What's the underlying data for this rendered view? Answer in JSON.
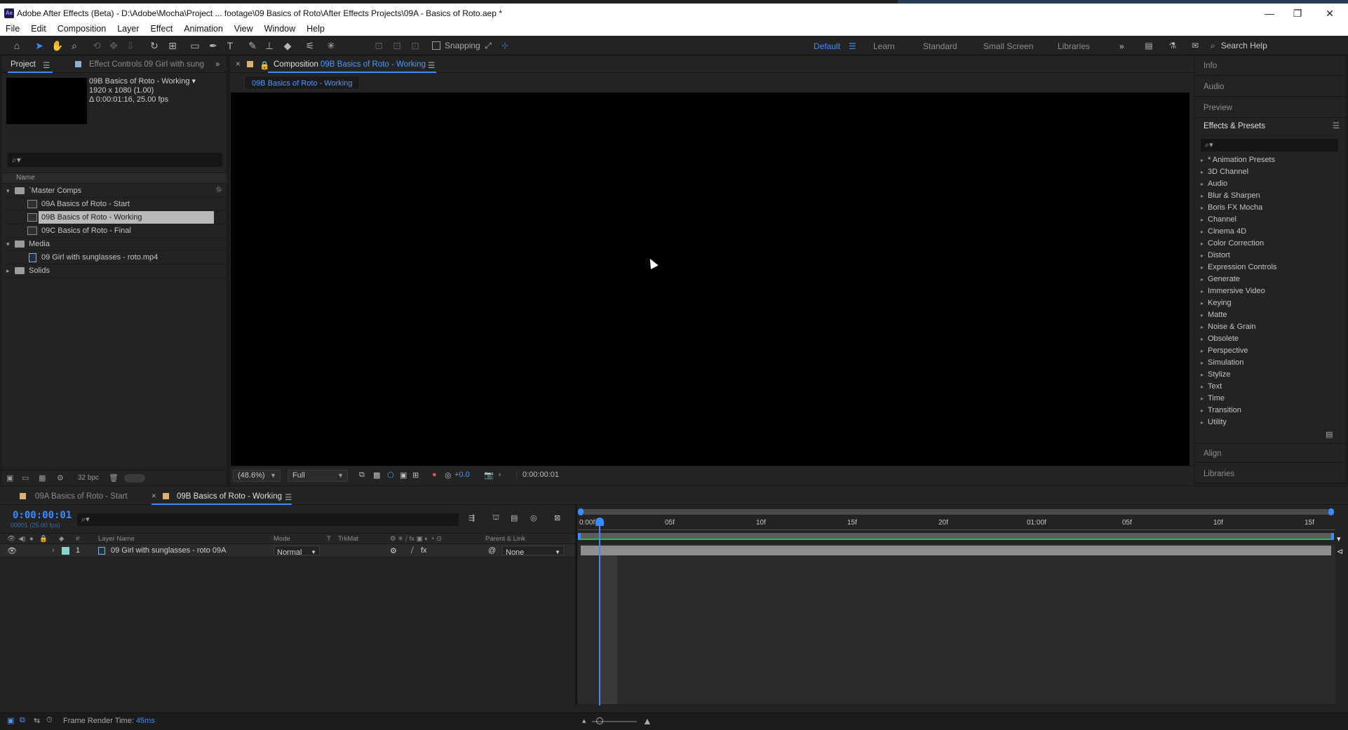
{
  "window": {
    "title": "Adobe After Effects (Beta) - D:\\Adobe\\Mocha\\Project ... footage\\09 Basics of Roto\\After Effects Projects\\09A - Basics of Roto.aep *",
    "app_icon": "Ae",
    "minimize": "—",
    "maximize": "❐",
    "close": "✕"
  },
  "menu": [
    "File",
    "Edit",
    "Composition",
    "Layer",
    "Effect",
    "Animation",
    "View",
    "Window",
    "Help"
  ],
  "toolbar": {
    "snapping_label": "Snapping",
    "workspaces": [
      "Default",
      "Learn",
      "Standard",
      "Small Screen",
      "Libraries"
    ],
    "active_workspace": "Default",
    "more": "»",
    "search_help": "Search Help"
  },
  "project": {
    "tab_project": "Project",
    "tab_effect_controls": "Effect Controls 09 Girl with sung",
    "selected_name": "09B Basics of Roto - Working ▾",
    "selected_res": "1920 x 1080 (1.00)",
    "selected_duration": "Δ 0:00:01:16, 25.00 fps",
    "search_placeholder": "⌕▾",
    "name_header": "Name",
    "tree": [
      {
        "label": "`Master Comps",
        "type": "folder",
        "indent": 0,
        "expanded": true
      },
      {
        "label": "09A Basics of Roto - Start",
        "type": "comp",
        "indent": 1
      },
      {
        "label": "09B Basics of Roto - Working",
        "type": "comp",
        "indent": 1,
        "selected": true
      },
      {
        "label": "09C Basics of Roto - Final",
        "type": "comp",
        "indent": 1
      },
      {
        "label": "Media",
        "type": "folder",
        "indent": 0,
        "expanded": true
      },
      {
        "label": "09 Girl with sunglasses - roto.mp4",
        "type": "file",
        "indent": 1
      },
      {
        "label": "Solids",
        "type": "folder",
        "indent": 0,
        "expanded": false
      }
    ],
    "bpc": "32 bpc"
  },
  "composition": {
    "tab_prefix": "Composition",
    "tab_name": "09B Basics of Roto - Working",
    "breadcrumb": "09B Basics of Roto - Working",
    "zoom": "(48.6%)",
    "resolution": "Full",
    "exposure": "+0.0",
    "timecode": "0:00:00:01"
  },
  "right_panel": {
    "info": "Info",
    "audio": "Audio",
    "preview": "Preview",
    "effects_presets": "Effects & Presets",
    "search_placeholder": "⌕▾",
    "effects": [
      "* Animation Presets",
      "3D Channel",
      "Audio",
      "Blur & Sharpen",
      "Boris FX Mocha",
      "Channel",
      "Cinema 4D",
      "Color Correction",
      "Distort",
      "Expression Controls",
      "Generate",
      "Immersive Video",
      "Keying",
      "Matte",
      "Noise & Grain",
      "Obsolete",
      "Perspective",
      "Simulation",
      "Stylize",
      "Text",
      "Time",
      "Transition",
      "Utility"
    ],
    "align": "Align",
    "libraries": "Libraries"
  },
  "timeline": {
    "tab1": "09A Basics of Roto - Start",
    "tab2": "09B Basics of Roto - Working",
    "timecode": "0:00:00:01",
    "sub_timecode": "00001 (25.00 fps)",
    "search_placeholder": "⌕▾",
    "col_hash": "#",
    "col_layer_name": "Layer Name",
    "col_mode": "Mode",
    "col_t": "T",
    "col_trkmat": "TrkMat",
    "col_parent": "Parent & Link",
    "layer": {
      "index": "1",
      "name": "09 Girl with sunglasses - roto  09A",
      "mode": "Normal",
      "parent": "None"
    },
    "ruler_labels": [
      "0:00f",
      "05f",
      "10f",
      "15f",
      "20f",
      "01:00f",
      "05f",
      "10f",
      "15f"
    ]
  },
  "status": {
    "render_label": "Frame Render Time:",
    "render_value": "45ms"
  },
  "colors": {
    "accent": "#3c8cff",
    "work_area": "#2ab54f",
    "panel_bg": "#232323"
  }
}
